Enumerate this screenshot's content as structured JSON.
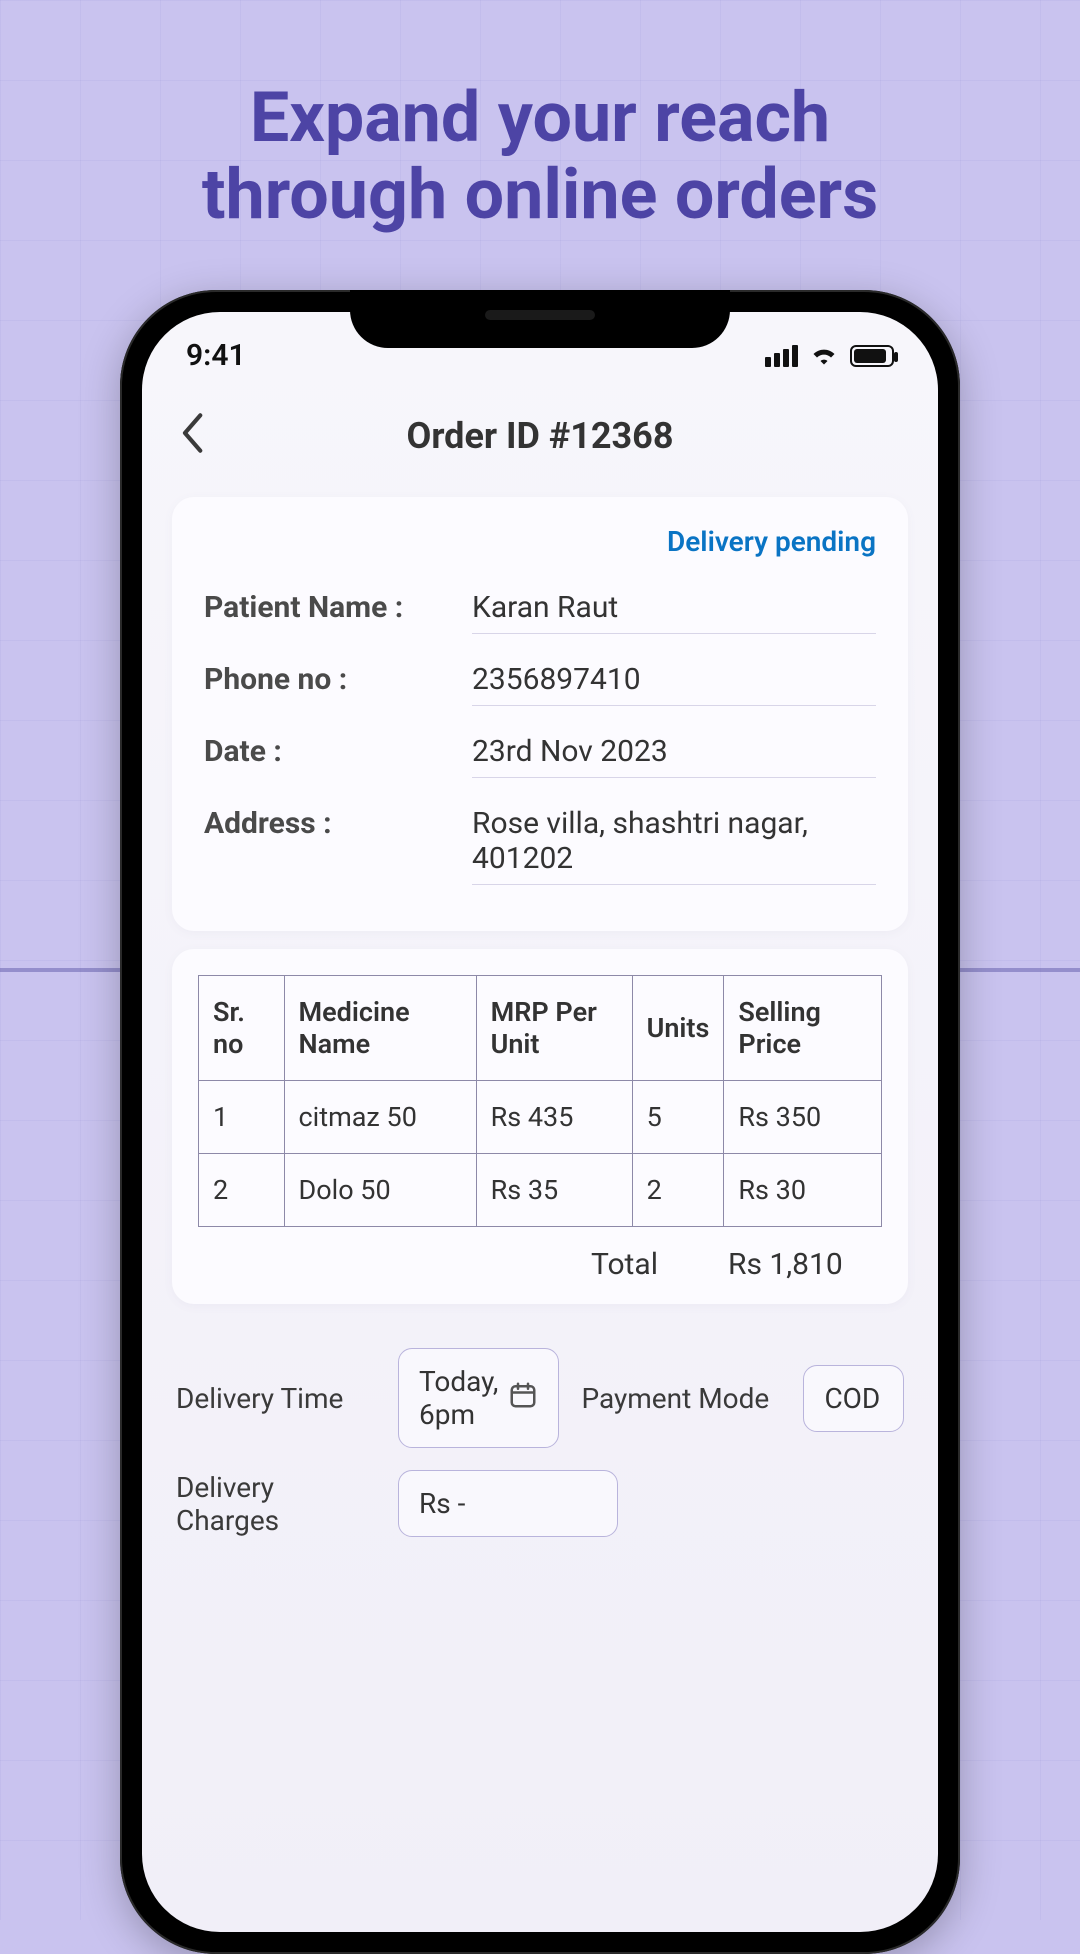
{
  "promo": {
    "headline_line1": "Expand your reach",
    "headline_line2": "through online orders"
  },
  "statusbar": {
    "time": "9:41"
  },
  "header": {
    "title": "Order ID #12368"
  },
  "order": {
    "status": "Delivery pending",
    "labels": {
      "patient": "Patient Name :",
      "phone": "Phone no :",
      "date": "Date :",
      "address": "Address :"
    },
    "patient": "Karan Raut",
    "phone": "2356897410",
    "date": "23rd Nov 2023",
    "address": "Rose villa, shashtri nagar, 401202"
  },
  "table": {
    "headers": {
      "sr": "Sr. no",
      "med": "Medicine Name",
      "mrp": "MRP Per Unit",
      "units": "Units",
      "sell": "Selling Price"
    },
    "rows": [
      {
        "sr": "1",
        "med": "citmaz 50",
        "mrp": "Rs 435",
        "units": "5",
        "sell": "Rs 350"
      },
      {
        "sr": "2",
        "med": "Dolo 50",
        "mrp": "Rs 35",
        "units": "2",
        "sell": "Rs 30"
      }
    ],
    "total_label": "Total",
    "total_value": "Rs 1,810"
  },
  "delivery": {
    "time_label": "Delivery Time",
    "time_value": "Today, 6pm",
    "payment_label": "Payment Mode",
    "payment_value": "COD",
    "charges_label": "Delivery Charges",
    "charges_value": "Rs -"
  }
}
